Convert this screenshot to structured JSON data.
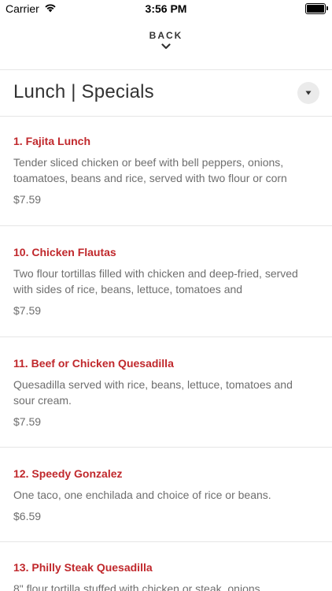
{
  "status_bar": {
    "carrier": "Carrier",
    "time": "3:56 PM"
  },
  "nav": {
    "back_label": "BACK"
  },
  "category": {
    "title": "Lunch | Specials"
  },
  "items": [
    {
      "name": "1. Fajita Lunch",
      "description": "Tender sliced chicken or beef with bell peppers, onions, toamatoes, beans and rice, served with two flour or corn",
      "price": "$7.59"
    },
    {
      "name": "10. Chicken Flautas",
      "description": "Two flour tortillas filled with chicken and deep-fried, served with sides of rice, beans, lettuce, tomatoes and",
      "price": "$7.59"
    },
    {
      "name": "11. Beef or Chicken Quesadilla",
      "description": "Quesadilla served with rice, beans, lettuce, tomatoes and sour cream.",
      "price": "$7.59"
    },
    {
      "name": "12. Speedy Gonzalez",
      "description": "One taco, one enchilada and choice of rice or beans.",
      "price": "$6.59"
    },
    {
      "name": "13. Philly Steak Quesadilla",
      "description": "8\" flour tortilla stuffed with chicken or steak, onions,",
      "price": ""
    }
  ],
  "colors": {
    "item_title": "#c0282c",
    "text_muted": "#6e6e6e",
    "divider": "#e6e6e6"
  }
}
